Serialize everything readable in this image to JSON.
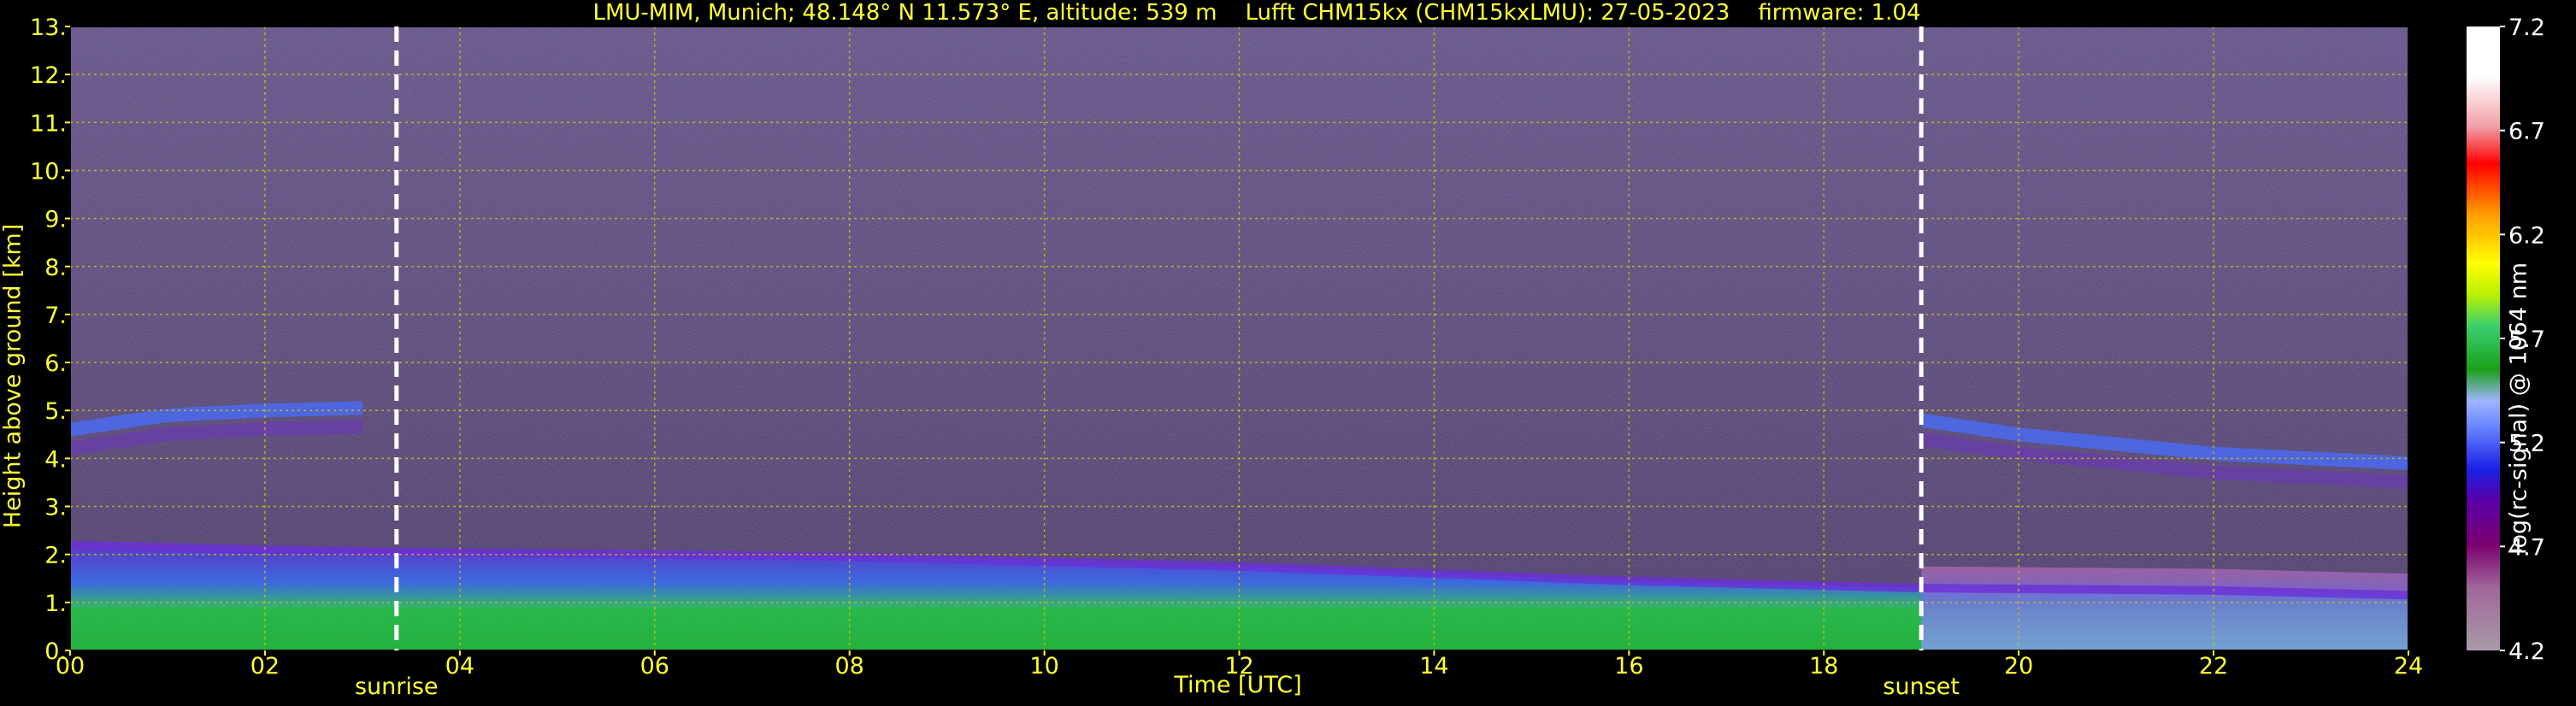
{
  "title": "LMU-MIM, Munich; 48.148° N 11.573° E, altitude: 539 m    Lufft CHM15kx (CHM15kxLMU): 27-05-2023    firmware: 1.04",
  "chart_data": {
    "type": "heatmap",
    "xlabel": "Time [UTC]",
    "ylabel": "Height above ground [km]",
    "xlim": [
      0,
      24
    ],
    "ylim": [
      0,
      13
    ],
    "x_ticks": [
      "00",
      "02",
      "04",
      "06",
      "08",
      "10",
      "12",
      "14",
      "16",
      "18",
      "20",
      "22",
      "24"
    ],
    "y_ticks": [
      "0.",
      "1.",
      "2.",
      "3.",
      "4.",
      "5.",
      "6.",
      "7.",
      "8.",
      "9.",
      "10.",
      "11.",
      "12.",
      "13."
    ],
    "grid": true,
    "markers": [
      {
        "label": "sunrise",
        "x": 3.35
      },
      {
        "label": "sunset",
        "x": 19.0
      }
    ],
    "colorbar": {
      "label": "log(rc-signal) @ 1064 nm",
      "range": [
        4.2,
        7.2
      ],
      "ticks": [
        "4.2",
        "4.7",
        "5.2",
        "5.7",
        "6.2",
        "6.7",
        "7.2"
      ]
    },
    "layers": [
      {
        "name": "boundary layer top",
        "x": [
          0,
          2,
          3.35,
          6,
          8,
          10,
          12,
          14,
          16,
          18,
          19,
          22,
          24
        ],
        "y": [
          2.2,
          2.1,
          2.05,
          2.0,
          1.95,
          1.85,
          1.75,
          1.6,
          1.45,
          1.35,
          1.3,
          1.25,
          1.15
        ]
      },
      {
        "name": "elevated aerosol layer",
        "x": [
          0,
          1,
          2,
          3,
          19,
          20,
          22,
          24
        ],
        "y": [
          4.6,
          4.9,
          5.0,
          5.05,
          4.8,
          4.5,
          4.1,
          3.9
        ]
      }
    ]
  },
  "colors": {
    "background": "#000000",
    "text": "#ffff33",
    "grid": "#d4c800",
    "marker_line": "#ffffff"
  }
}
